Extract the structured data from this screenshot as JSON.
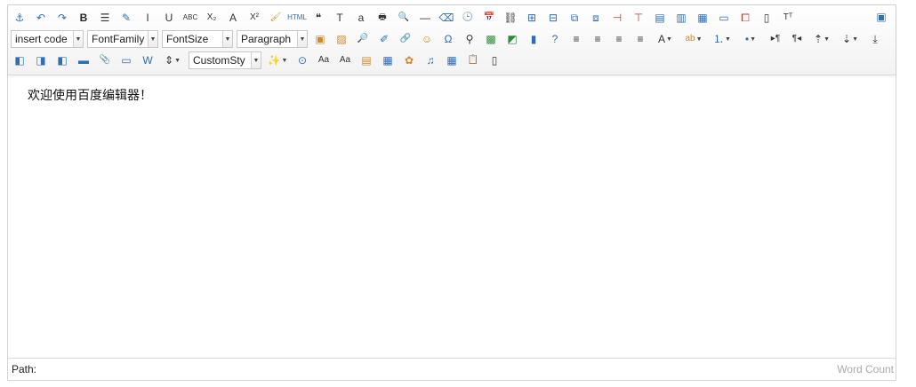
{
  "editor": {
    "content_text": "欢迎使用百度编辑器！",
    "status": {
      "path_label": "Path:",
      "word_count_label": "Word Count"
    }
  },
  "toolbar": {
    "row1": [
      {
        "name": "anchor-icon",
        "glyph": "⚓",
        "cls": "sym-blue"
      },
      {
        "name": "undo-icon",
        "glyph": "↶",
        "cls": "sym-blue"
      },
      {
        "name": "redo-icon",
        "glyph": "↷",
        "cls": "sym-blue"
      },
      {
        "name": "bold-icon",
        "glyph": "B",
        "cls": "sym-dark"
      },
      {
        "name": "indent-icon",
        "glyph": "☰",
        "cls": ""
      },
      {
        "name": "edit-tip-icon",
        "glyph": "✎",
        "cls": "sym-blue"
      },
      {
        "name": "italic-icon",
        "glyph": "I",
        "cls": ""
      },
      {
        "name": "underline-icon",
        "glyph": "U",
        "cls": ""
      },
      {
        "name": "strikethrough-icon",
        "glyph": "ABC",
        "cls": ""
      },
      {
        "name": "subscript-icon",
        "glyph": "X₂",
        "cls": ""
      },
      {
        "name": "fontborder-icon",
        "glyph": "A",
        "cls": ""
      },
      {
        "name": "superscript-icon",
        "glyph": "X²",
        "cls": ""
      },
      {
        "name": "format-match-icon",
        "glyph": "🖌",
        "cls": "sym-orange"
      },
      {
        "name": "source-html-icon",
        "glyph": "HTML",
        "cls": "sym-blue"
      },
      {
        "name": "blockquote-icon",
        "glyph": "❝",
        "cls": ""
      },
      {
        "name": "paste-plain-icon",
        "glyph": "T",
        "cls": ""
      },
      {
        "name": "select-all-icon",
        "glyph": "a",
        "cls": ""
      },
      {
        "name": "print-icon",
        "glyph": "🖶",
        "cls": ""
      },
      {
        "name": "preview-icon",
        "glyph": "🔍",
        "cls": ""
      },
      {
        "name": "horizontal-rule-icon",
        "glyph": "—",
        "cls": ""
      },
      {
        "name": "remove-format-icon",
        "glyph": "⌫",
        "cls": "sym-blue"
      },
      {
        "name": "time-icon",
        "glyph": "🕒",
        "cls": ""
      },
      {
        "name": "date-icon",
        "glyph": "📅",
        "cls": "sym-red"
      },
      {
        "name": "unlink-icon",
        "glyph": "⛓",
        "cls": ""
      },
      {
        "name": "insert-row-icon",
        "glyph": "⊞",
        "cls": "sym-blue"
      },
      {
        "name": "insert-col-icon",
        "glyph": "⊟",
        "cls": "sym-blue"
      },
      {
        "name": "merge-right-icon",
        "glyph": "⧉",
        "cls": "sym-blue"
      },
      {
        "name": "merge-down-icon",
        "glyph": "⧈",
        "cls": "sym-blue"
      },
      {
        "name": "delete-row-icon",
        "glyph": "⊣",
        "cls": "sym-red"
      },
      {
        "name": "delete-col-icon",
        "glyph": "⊤",
        "cls": "sym-red"
      },
      {
        "name": "split-rows-icon",
        "glyph": "▤",
        "cls": "sym-blue"
      },
      {
        "name": "split-cols-icon",
        "glyph": "▥",
        "cls": "sym-blue"
      },
      {
        "name": "split-cells-icon",
        "glyph": "▦",
        "cls": "sym-blue"
      },
      {
        "name": "delete-caption-icon",
        "glyph": "▭",
        "cls": "sym-blue"
      },
      {
        "name": "insert-title-icon",
        "glyph": "⧠",
        "cls": "sym-red"
      },
      {
        "name": "merge-cells-icon",
        "glyph": "▯",
        "cls": ""
      },
      {
        "name": "delete-table-icon",
        "glyph": "Tᵀ",
        "cls": ""
      }
    ],
    "row2_selects": [
      {
        "name": "insertcode-select",
        "label": "insert code",
        "width": 82
      },
      {
        "name": "fontfamily-select",
        "label": "FontFamily",
        "width": 80
      },
      {
        "name": "fontsize-select",
        "label": "FontSize",
        "width": 80
      },
      {
        "name": "paragraph-select",
        "label": "Paragraph",
        "width": 80
      }
    ],
    "row2_buttons": [
      {
        "name": "simple-upload-icon",
        "glyph": "▣",
        "cls": "sym-orange"
      },
      {
        "name": "insert-image-icon",
        "glyph": "▨",
        "cls": "sym-orange"
      },
      {
        "name": "emotion-search-icon",
        "glyph": "🔎",
        "cls": "sym-blue"
      },
      {
        "name": "scrawl-icon",
        "glyph": "✐",
        "cls": "sym-blue"
      },
      {
        "name": "link-icon",
        "glyph": "🔗",
        "cls": ""
      },
      {
        "name": "emotion-icon",
        "glyph": "☺",
        "cls": "sym-orange"
      },
      {
        "name": "special-chars-icon",
        "glyph": "Ω",
        "cls": "sym-blue"
      },
      {
        "name": "search-replace-icon",
        "glyph": "⚲",
        "cls": ""
      },
      {
        "name": "map-icon",
        "glyph": "▩",
        "cls": "sym-green"
      },
      {
        "name": "gmap-icon",
        "glyph": "◩",
        "cls": "sym-green"
      },
      {
        "name": "insert-video-icon",
        "glyph": "▮",
        "cls": "sym-blue"
      },
      {
        "name": "help-icon",
        "glyph": "?",
        "cls": "sym-blue"
      },
      {
        "name": "align-left-icon",
        "glyph": "≡",
        "cls": ""
      },
      {
        "name": "align-right-icon",
        "glyph": "≡",
        "cls": ""
      },
      {
        "name": "align-center-icon",
        "glyph": "≡",
        "cls": ""
      },
      {
        "name": "align-justify-icon",
        "glyph": "≡",
        "cls": ""
      },
      {
        "name": "forecolor-icon",
        "glyph": "A",
        "cls": "",
        "dd": true
      },
      {
        "name": "backcolor-icon",
        "glyph": "ab",
        "cls": "sym-orange",
        "dd": true
      },
      {
        "name": "ordered-list-icon",
        "glyph": "⒈",
        "cls": "sym-blue",
        "dd": true
      },
      {
        "name": "unordered-list-icon",
        "glyph": "•",
        "cls": "sym-blue",
        "dd": true
      },
      {
        "name": "directionality-ltr-icon",
        "glyph": "▸¶",
        "cls": ""
      },
      {
        "name": "directionality-rtl-icon",
        "glyph": "¶◂",
        "cls": ""
      },
      {
        "name": "row-spacing-top-icon",
        "glyph": "⇡",
        "cls": "",
        "dd": true
      },
      {
        "name": "row-spacing-bottom-icon",
        "glyph": "⇣",
        "cls": "",
        "dd": true
      },
      {
        "name": "page-break-icon",
        "glyph": "⤓",
        "cls": ""
      }
    ],
    "row3_buttons": [
      {
        "name": "image-none-icon",
        "glyph": "◧",
        "cls": "sym-blue"
      },
      {
        "name": "image-left-icon",
        "glyph": "◨",
        "cls": "sym-blue"
      },
      {
        "name": "image-right-icon",
        "glyph": "◧",
        "cls": "sym-blue"
      },
      {
        "name": "image-center-icon",
        "glyph": "▬",
        "cls": "sym-blue"
      },
      {
        "name": "attachment-icon",
        "glyph": "📎",
        "cls": "sym-blue"
      },
      {
        "name": "insert-frame-icon",
        "glyph": "▭",
        "cls": "sym-blue"
      },
      {
        "name": "word-image-icon",
        "glyph": "W",
        "cls": "sym-blue"
      },
      {
        "name": "line-height-icon",
        "glyph": "⇕",
        "cls": "",
        "dd": true
      }
    ],
    "row3_select": {
      "name": "customstyle-select",
      "label": "CustomSty",
      "width": 82
    },
    "row3_buttons_after": [
      {
        "name": "magic-wand-icon",
        "glyph": "✨",
        "cls": "sym-orange",
        "dd": true
      },
      {
        "name": "autotypeset-icon",
        "glyph": "⊙",
        "cls": "sym-blue"
      },
      {
        "name": "to-upper-icon",
        "glyph": "Aa",
        "cls": ""
      },
      {
        "name": "to-lower-icon",
        "glyph": "Aa",
        "cls": ""
      },
      {
        "name": "insert-gallery-icon",
        "glyph": "▤",
        "cls": "sym-orange"
      },
      {
        "name": "template-icon",
        "glyph": "▦",
        "cls": "sym-blue"
      },
      {
        "name": "background-icon",
        "glyph": "✿",
        "cls": "sym-orange"
      },
      {
        "name": "music-icon",
        "glyph": "♫",
        "cls": "sym-blue"
      },
      {
        "name": "insert-table-icon",
        "glyph": "▦",
        "cls": "sym-blue"
      },
      {
        "name": "paste-icon",
        "glyph": "📋",
        "cls": ""
      },
      {
        "name": "draft-icon",
        "glyph": "▯",
        "cls": ""
      }
    ],
    "fullscreen": {
      "name": "fullscreen-icon",
      "glyph": "▣",
      "cls": "sym-blue"
    }
  }
}
